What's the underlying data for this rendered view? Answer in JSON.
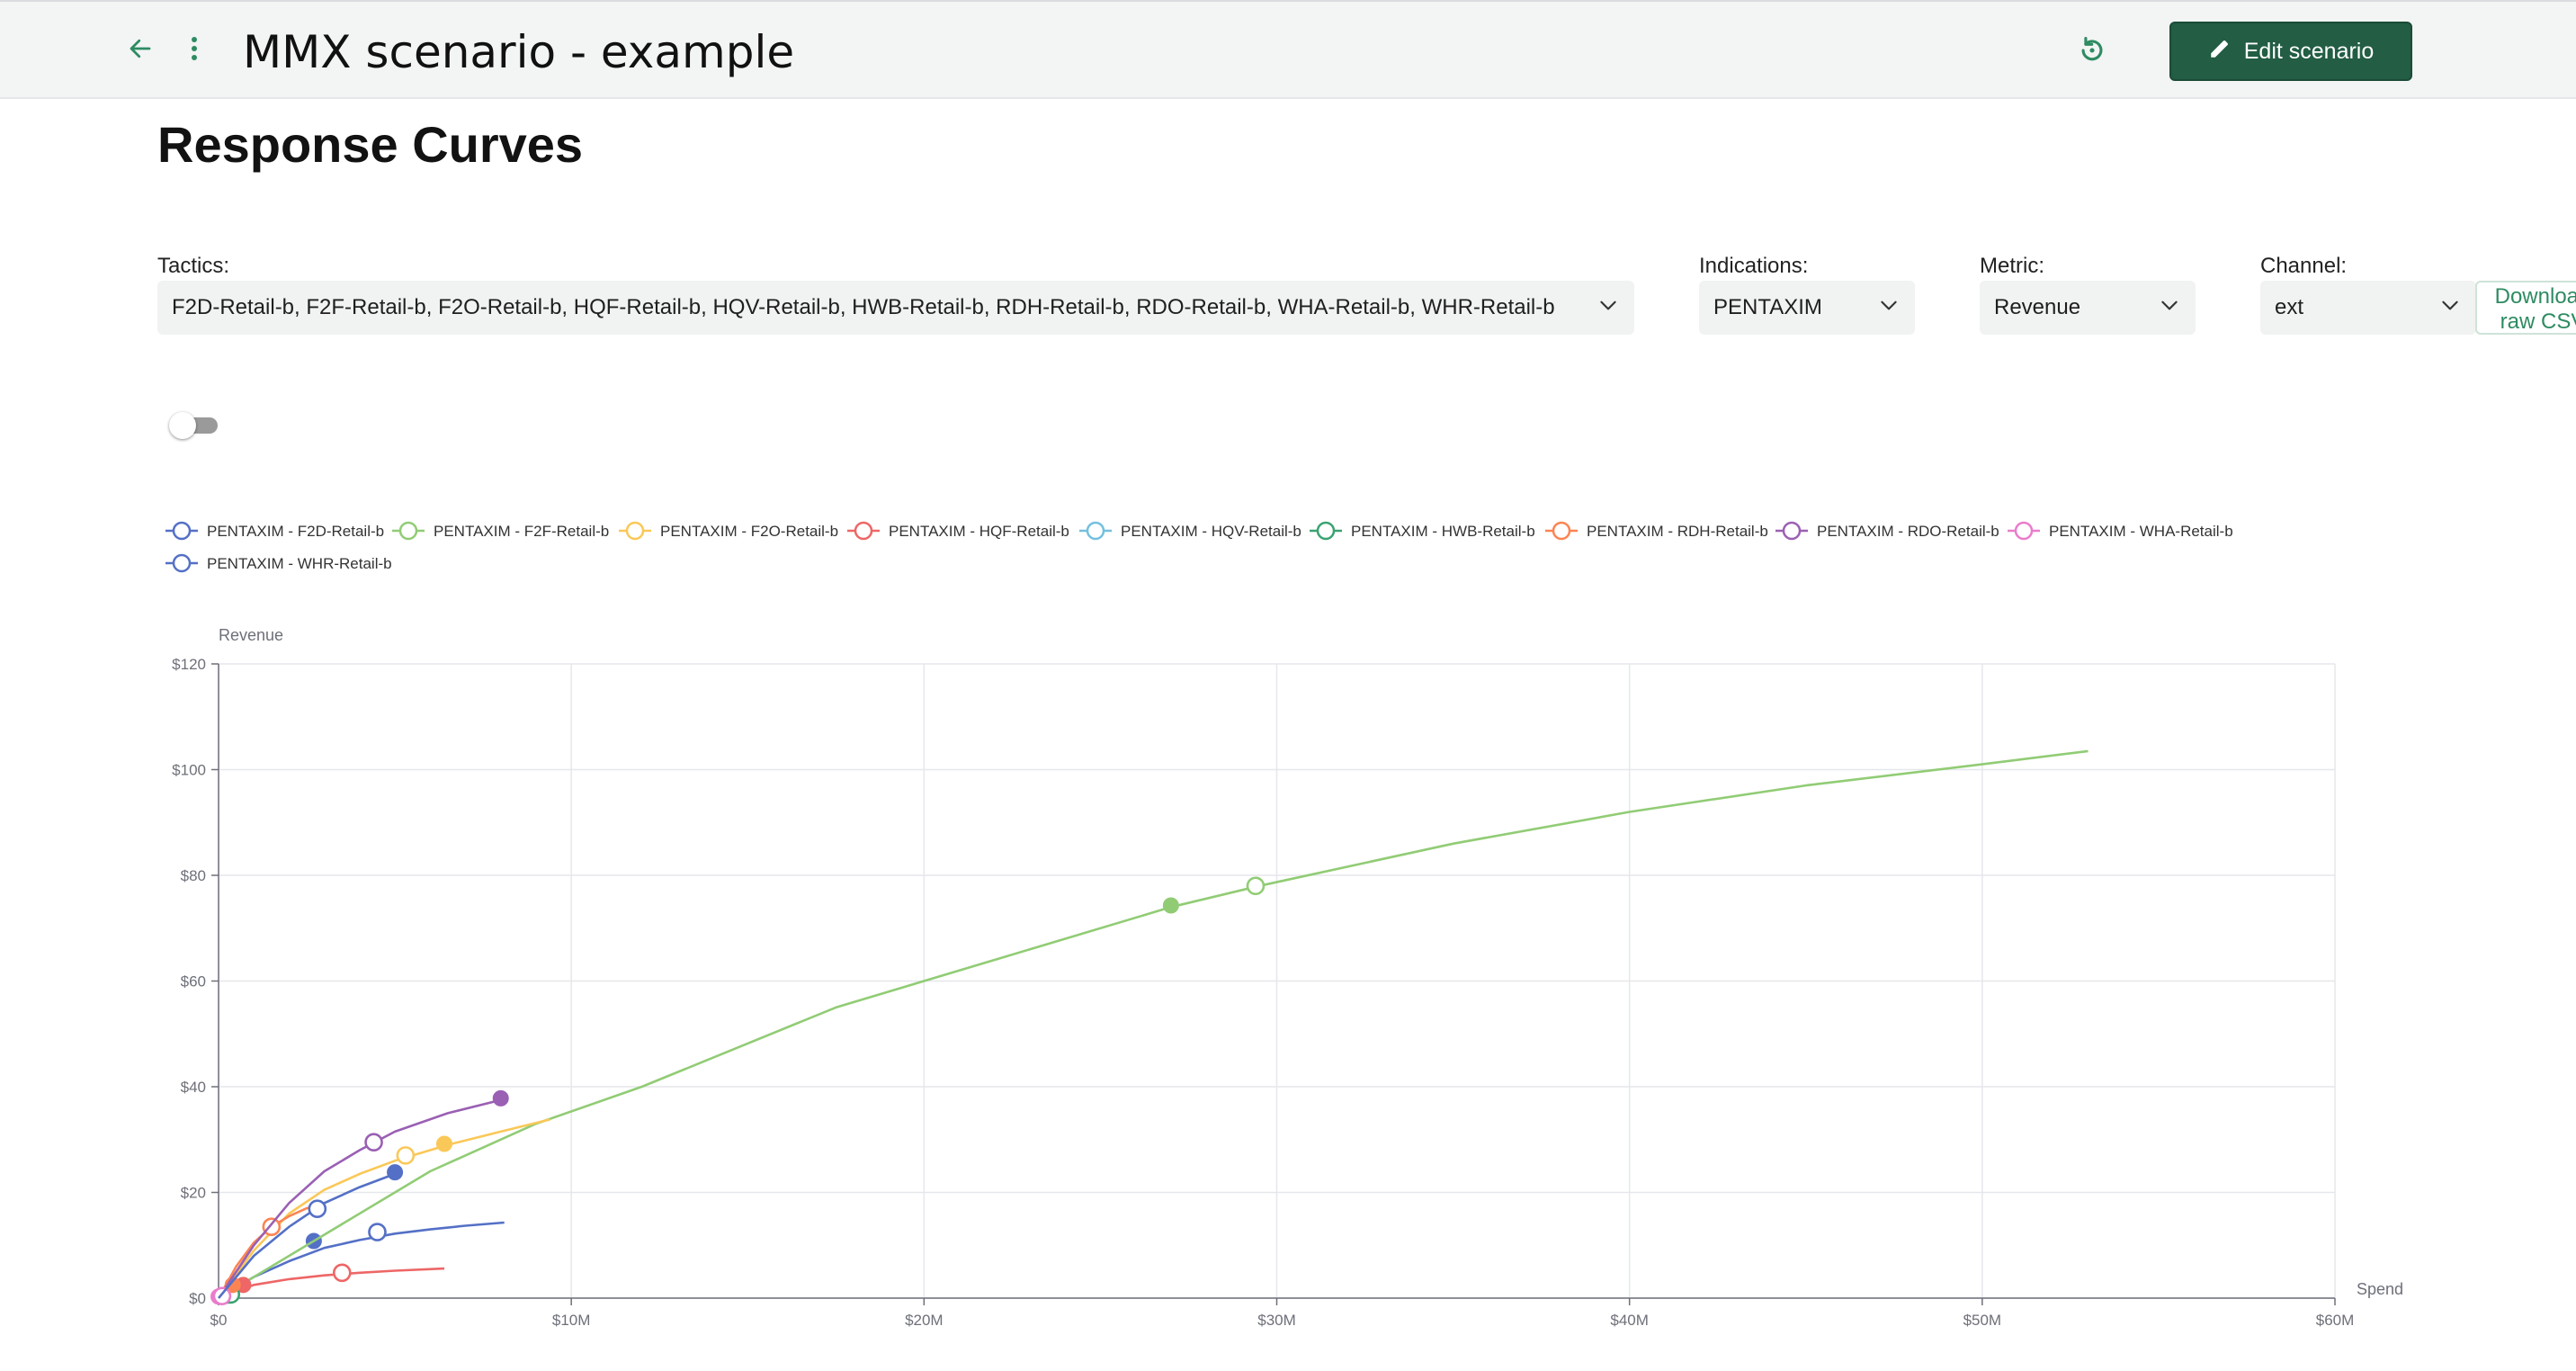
{
  "header": {
    "title": "MMX scenario - example",
    "edit_button_label": "Edit scenario",
    "back_icon": "arrow-left-icon",
    "more_icon": "more-vertical-icon",
    "reset_icon": "history-icon",
    "edit_icon": "pencil-icon"
  },
  "section": {
    "title": "Response Curves"
  },
  "filters": {
    "tactics": {
      "label": "Tactics:",
      "value": "F2D-Retail-b, F2F-Retail-b, F2O-Retail-b, HQF-Retail-b, HQV-Retail-b, HWB-Retail-b, RDH-Retail-b, RDO-Retail-b, WHA-Retail-b, WHR-Retail-b"
    },
    "indications": {
      "label": "Indications:",
      "value": "PENTAXIM"
    },
    "metric": {
      "label": "Metric:",
      "value": "Revenue"
    },
    "channel": {
      "label": "Channel:",
      "value": "ext"
    },
    "download": {
      "line1": "Download",
      "line2": "raw CSV",
      "icon": "download-icon"
    }
  },
  "toggle": {
    "on": false
  },
  "colors": {
    "accent": "#225d44",
    "link": "#2e8b62",
    "grid": "#e5e7eb"
  },
  "chart_data": {
    "type": "line",
    "ylabel": "Revenue",
    "xlabel": "Spend",
    "xlim": [
      0,
      60
    ],
    "ylim": [
      0,
      120
    ],
    "x_ticks": [
      "$0",
      "$10M",
      "$20M",
      "$30M",
      "$40M",
      "$50M",
      "$60M"
    ],
    "y_ticks": [
      "$0",
      "$20",
      "$40",
      "$60",
      "$80",
      "$100",
      "$120"
    ],
    "grid": true,
    "legend_position": "top-left",
    "series": [
      {
        "name": "PENTAXIM - F2D-Retail-b",
        "color": "#5470c6",
        "points": [
          [
            0,
            0
          ],
          [
            1,
            4
          ],
          [
            2,
            7
          ],
          [
            3,
            9.5
          ],
          [
            4,
            11
          ],
          [
            5,
            12.2
          ],
          [
            6,
            13
          ],
          [
            7,
            13.7
          ],
          [
            8.1,
            14.3
          ]
        ],
        "current": [
          4.5,
          12.5
        ],
        "optimized": [
          2.7,
          10.8
        ]
      },
      {
        "name": "PENTAXIM - F2F-Retail-b",
        "color": "#91cc75",
        "points": [
          [
            0,
            0
          ],
          [
            3,
            12
          ],
          [
            6,
            24
          ],
          [
            9,
            33
          ],
          [
            12,
            40
          ],
          [
            17.5,
            55
          ],
          [
            22,
            64
          ],
          [
            27,
            74
          ],
          [
            29.5,
            78
          ],
          [
            35,
            86
          ],
          [
            40,
            92
          ],
          [
            45,
            97
          ],
          [
            50,
            101
          ],
          [
            53,
            103.5
          ]
        ],
        "current": [
          29.4,
          78
        ],
        "optimized": [
          27.0,
          74.3
        ]
      },
      {
        "name": "PENTAXIM - F2O-Retail-b",
        "color": "#fac858",
        "points": [
          [
            0,
            0
          ],
          [
            1,
            9
          ],
          [
            2,
            16
          ],
          [
            3,
            20.5
          ],
          [
            4,
            23.5
          ],
          [
            5,
            26
          ],
          [
            6.5,
            29
          ],
          [
            8,
            31.5
          ],
          [
            9.4,
            33.8
          ]
        ],
        "current": [
          5.3,
          27
        ],
        "optimized": [
          6.4,
          29.2
        ]
      },
      {
        "name": "PENTAXIM - HQF-Retail-b",
        "color": "#ee6666",
        "points": [
          [
            0,
            0
          ],
          [
            1,
            2.5
          ],
          [
            2,
            3.6
          ],
          [
            3,
            4.3
          ],
          [
            4,
            4.8
          ],
          [
            5,
            5.2
          ],
          [
            6.4,
            5.6
          ]
        ],
        "current": [
          3.5,
          4.8
        ],
        "optimized": [
          0.7,
          2.5
        ]
      },
      {
        "name": "PENTAXIM - HQV-Retail-b",
        "color": "#73c0de",
        "points": [
          [
            0,
            0
          ],
          [
            0.2,
            0.5
          ],
          [
            0.4,
            0.9
          ]
        ],
        "current": [
          0.3,
          0.7
        ],
        "optimized": [
          0.2,
          0.5
        ]
      },
      {
        "name": "PENTAXIM - HWB-Retail-b",
        "color": "#3ba272",
        "points": [
          [
            0,
            0
          ],
          [
            0.2,
            0.4
          ],
          [
            0.4,
            0.8
          ]
        ],
        "current": [
          0.35,
          0.7
        ],
        "optimized": [
          0.2,
          0.4
        ]
      },
      {
        "name": "PENTAXIM - RDH-Retail-b",
        "color": "#fc8452",
        "points": [
          [
            0,
            0
          ],
          [
            0.5,
            6
          ],
          [
            1,
            10.5
          ],
          [
            1.5,
            13.5
          ],
          [
            2,
            15.5
          ],
          [
            2.5,
            17
          ],
          [
            3,
            18
          ]
        ],
        "current": [
          1.5,
          13.5
        ],
        "optimized": [
          0.4,
          2.5
        ]
      },
      {
        "name": "PENTAXIM - RDO-Retail-b",
        "color": "#9a60b4",
        "points": [
          [
            0,
            0
          ],
          [
            1,
            10
          ],
          [
            2,
            18
          ],
          [
            3,
            24
          ],
          [
            4,
            28
          ],
          [
            5,
            31.5
          ],
          [
            6.5,
            35
          ],
          [
            8,
            37.5
          ]
        ],
        "current": [
          4.4,
          29.5
        ],
        "optimized": [
          8.0,
          37.8
        ]
      },
      {
        "name": "PENTAXIM - WHA-Retail-b",
        "color": "#ea7ccc",
        "points": [
          [
            0,
            0
          ],
          [
            0.1,
            0.3
          ],
          [
            0.2,
            0.5
          ]
        ],
        "current": [
          0.1,
          0.4
        ],
        "optimized": [
          0.0,
          0.3
        ]
      },
      {
        "name": "PENTAXIM - WHR-Retail-b",
        "color": "#5470c6",
        "points": [
          [
            0,
            0
          ],
          [
            1,
            8
          ],
          [
            2,
            13.5
          ],
          [
            3,
            18
          ],
          [
            4,
            21
          ],
          [
            5,
            23.5
          ]
        ],
        "current": [
          2.8,
          16.9
        ],
        "optimized": [
          5.0,
          23.8
        ]
      }
    ]
  }
}
